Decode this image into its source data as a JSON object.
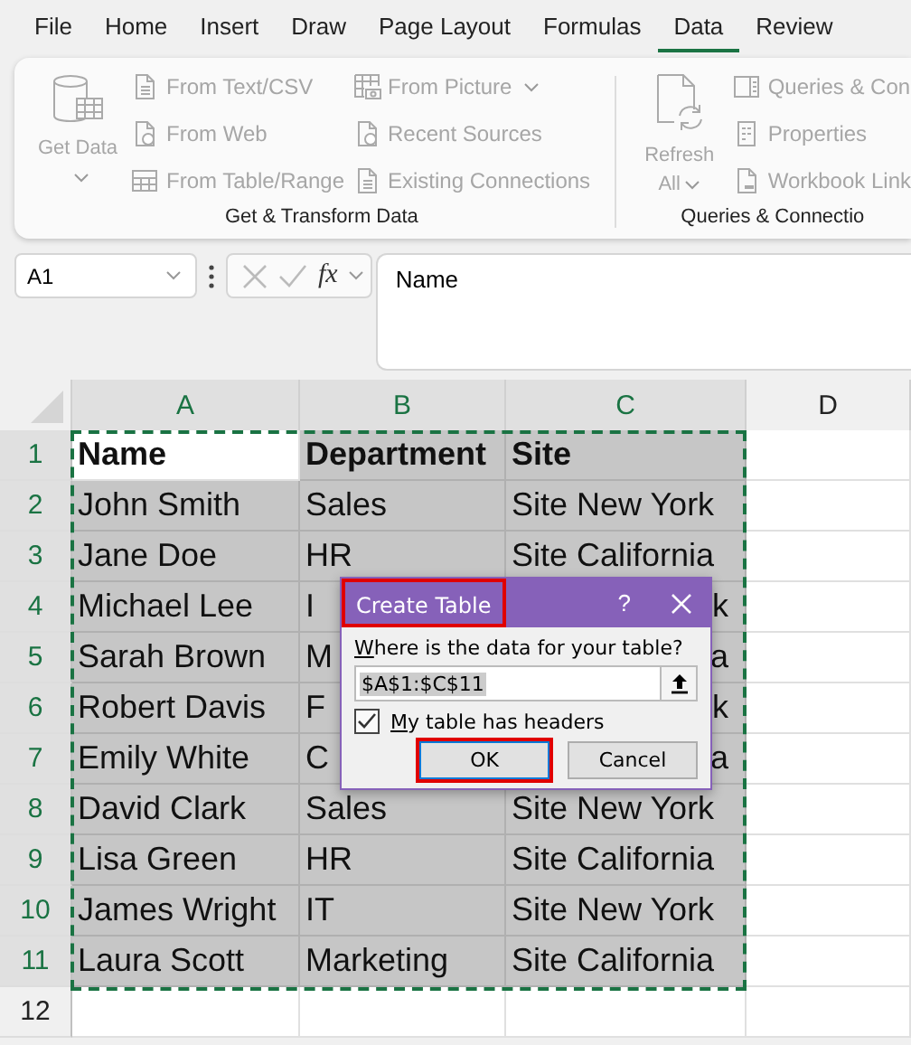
{
  "tabs": [
    {
      "label": "File",
      "selected": false
    },
    {
      "label": "Home",
      "selected": false
    },
    {
      "label": "Insert",
      "selected": false
    },
    {
      "label": "Draw",
      "selected": false
    },
    {
      "label": "Page Layout",
      "selected": false
    },
    {
      "label": "Formulas",
      "selected": false
    },
    {
      "label": "Data",
      "selected": true
    },
    {
      "label": "Review",
      "selected": false
    }
  ],
  "ribbon": {
    "disabled": true,
    "groups": [
      {
        "label": "Get & Transform Data",
        "big_button": {
          "label": "Get Data",
          "kind": "database",
          "dropdown": true
        },
        "columns": [
          [
            {
              "label": "From Text/CSV",
              "kind": "doc",
              "dropdown": false
            },
            {
              "label": "From Web",
              "kind": "web",
              "dropdown": false
            },
            {
              "label": "From Table/Range",
              "kind": "table",
              "dropdown": false
            }
          ],
          [
            {
              "label": "From Picture",
              "kind": "picture",
              "dropdown": true
            },
            {
              "label": "Recent Sources",
              "kind": "clock",
              "dropdown": false
            },
            {
              "label": "Existing Connections",
              "kind": "doc",
              "dropdown": false
            }
          ]
        ]
      },
      {
        "label": "Queries & Connectio",
        "big_button": {
          "label": "Refresh All",
          "kind": "refresh",
          "dropdown": true
        },
        "columns": [
          [
            {
              "label": "Queries & Con",
              "kind": "panel",
              "dropdown": false
            },
            {
              "label": "Properties",
              "kind": "list",
              "dropdown": false
            },
            {
              "label": "Workbook Link",
              "kind": "link",
              "dropdown": false
            }
          ]
        ]
      }
    ]
  },
  "formula_bar": {
    "name_box": "A1",
    "function_label": "fx",
    "formula": "Name"
  },
  "sheet": {
    "columns": [
      {
        "label": "A",
        "selected": true
      },
      {
        "label": "B",
        "selected": true
      },
      {
        "label": "C",
        "selected": true
      },
      {
        "label": "D",
        "selected": false
      }
    ],
    "rows": [
      {
        "label": "1",
        "selected": true,
        "cells": [
          {
            "text": "Name",
            "bold": true,
            "selected": false,
            "active": false
          },
          {
            "text": "Department",
            "bold": true,
            "selected": true,
            "active": false
          },
          {
            "text": "Site",
            "bold": true,
            "selected": true,
            "active": false
          }
        ]
      },
      {
        "label": "2",
        "selected": true,
        "cells": [
          {
            "text": "John Smith",
            "bold": false,
            "selected": true,
            "active": false
          },
          {
            "text": "Sales",
            "bold": false,
            "selected": true,
            "active": false
          },
          {
            "text": "Site New York",
            "bold": false,
            "selected": true,
            "active": false
          }
        ]
      },
      {
        "label": "3",
        "selected": true,
        "cells": [
          {
            "text": "Jane Doe",
            "bold": false,
            "selected": true,
            "active": false
          },
          {
            "text": "HR",
            "bold": false,
            "selected": true,
            "active": false
          },
          {
            "text": "Site California",
            "bold": false,
            "selected": true,
            "active": false
          }
        ]
      },
      {
        "label": "4",
        "selected": true,
        "cells": [
          {
            "text": "Michael Lee",
            "bold": false,
            "selected": true,
            "active": false
          },
          {
            "text": "I",
            "bold": false,
            "selected": true,
            "active": false
          },
          {
            "text": "k",
            "bold": false,
            "selected": true,
            "active": false,
            "cut": true
          }
        ]
      },
      {
        "label": "5",
        "selected": true,
        "cells": [
          {
            "text": "Sarah Brown",
            "bold": false,
            "selected": true,
            "active": false
          },
          {
            "text": "M",
            "bold": false,
            "selected": true,
            "active": false
          },
          {
            "text": "a",
            "bold": false,
            "selected": true,
            "active": false,
            "cut": true
          }
        ]
      },
      {
        "label": "6",
        "selected": true,
        "cells": [
          {
            "text": "Robert Davis",
            "bold": false,
            "selected": true,
            "active": false
          },
          {
            "text": "F",
            "bold": false,
            "selected": true,
            "active": false
          },
          {
            "text": "k",
            "bold": false,
            "selected": true,
            "active": false,
            "cut": true
          }
        ]
      },
      {
        "label": "7",
        "selected": true,
        "cells": [
          {
            "text": "Emily White",
            "bold": false,
            "selected": true,
            "active": false
          },
          {
            "text": "C",
            "bold": false,
            "selected": true,
            "active": false
          },
          {
            "text": "a",
            "bold": false,
            "selected": true,
            "active": false,
            "cut": true
          }
        ]
      },
      {
        "label": "8",
        "selected": true,
        "cells": [
          {
            "text": "David Clark",
            "bold": false,
            "selected": true,
            "active": false
          },
          {
            "text": "Sales",
            "bold": false,
            "selected": true,
            "active": false
          },
          {
            "text": "Site New York",
            "bold": false,
            "selected": true,
            "active": false
          }
        ]
      },
      {
        "label": "9",
        "selected": true,
        "cells": [
          {
            "text": "Lisa Green",
            "bold": false,
            "selected": true,
            "active": false
          },
          {
            "text": "HR",
            "bold": false,
            "selected": true,
            "active": false
          },
          {
            "text": "Site California",
            "bold": false,
            "selected": true,
            "active": false
          }
        ]
      },
      {
        "label": "10",
        "selected": true,
        "cells": [
          {
            "text": "James Wright",
            "bold": false,
            "selected": true,
            "active": false
          },
          {
            "text": "IT",
            "bold": false,
            "selected": true,
            "active": false
          },
          {
            "text": "Site New York",
            "bold": false,
            "selected": true,
            "active": false
          }
        ]
      },
      {
        "label": "11",
        "selected": true,
        "cells": [
          {
            "text": "Laura Scott",
            "bold": false,
            "selected": true,
            "active": false
          },
          {
            "text": "Marketing",
            "bold": false,
            "selected": true,
            "active": false
          },
          {
            "text": "Site California",
            "bold": false,
            "selected": true,
            "active": false
          }
        ]
      },
      {
        "label": "12",
        "selected": false,
        "cells": []
      }
    ]
  },
  "dialog": {
    "title": "Create Table",
    "title_annotated": true,
    "help": "?",
    "prompt": "Where is the data for your table?",
    "range": "$A$1:$C$11",
    "range_selected": true,
    "headers_checkbox": {
      "label": "My table has headers",
      "checked": true
    },
    "buttons": [
      {
        "label": "OK",
        "default": true,
        "annotated": true
      },
      {
        "label": "Cancel",
        "default": false,
        "annotated": false
      }
    ]
  }
}
